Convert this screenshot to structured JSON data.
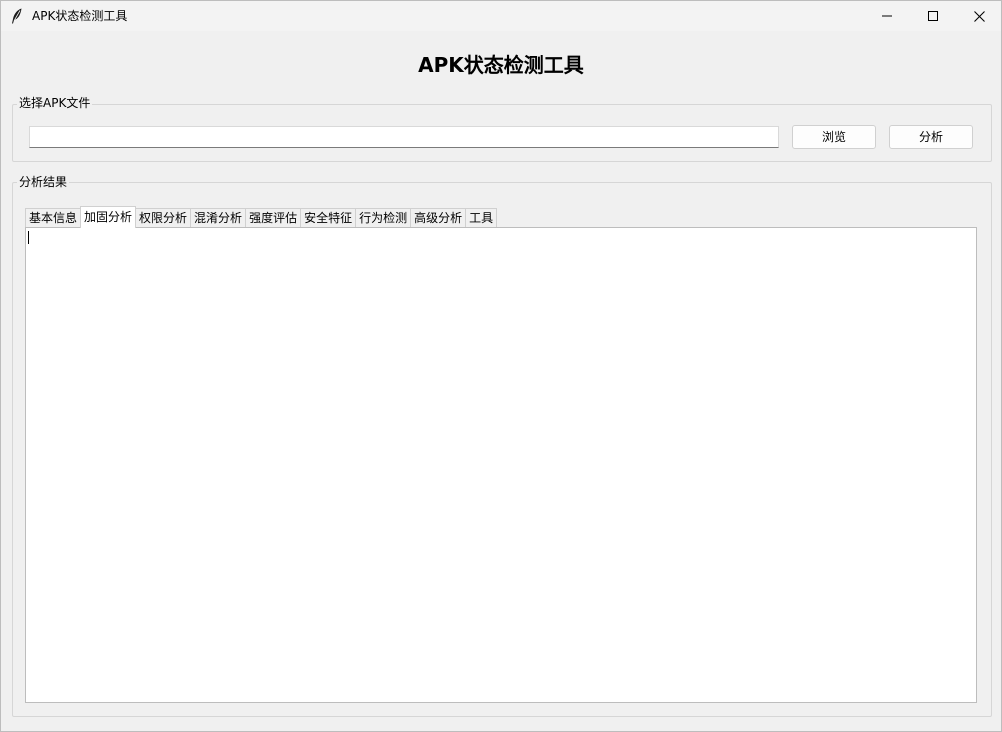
{
  "window": {
    "title": "APK状态检测工具",
    "icon": "feather-icon"
  },
  "header": {
    "title": "APK状态检测工具"
  },
  "file_section": {
    "label": "选择APK文件",
    "path_value": "",
    "browse_label": "浏览",
    "analyze_label": "分析"
  },
  "results_section": {
    "label": "分析结果",
    "active_tab": 1,
    "tabs": [
      {
        "label": "基本信息"
      },
      {
        "label": "加固分析"
      },
      {
        "label": "权限分析"
      },
      {
        "label": "混淆分析"
      },
      {
        "label": "强度评估"
      },
      {
        "label": "安全特征"
      },
      {
        "label": "行为检测"
      },
      {
        "label": "高级分析"
      },
      {
        "label": "工具"
      }
    ],
    "content_text": ""
  }
}
